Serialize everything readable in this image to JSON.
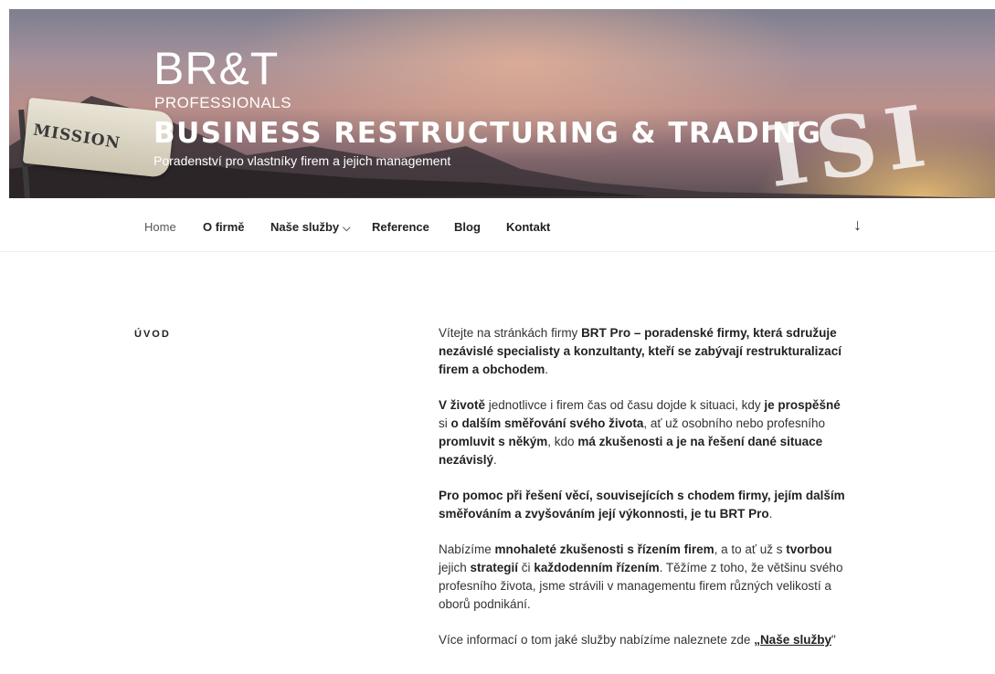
{
  "header": {
    "logo_main": "BR&T",
    "logo_sub": "PROFESSIONALS",
    "site_title": "BUSINESS RESTRUCTURING & TRADING",
    "site_description": "Poradenství pro vlastníky firem a jejich management",
    "banner_flag_text": "MISSION",
    "banner_big_letters": "ISI"
  },
  "nav": {
    "items": [
      {
        "label": "Home"
      },
      {
        "label": "O firmě"
      },
      {
        "label": "Naše služby"
      },
      {
        "label": "Reference"
      },
      {
        "label": "Blog"
      },
      {
        "label": "Kontakt"
      }
    ],
    "dropdown_icon": "chevron-down-icon",
    "scroll_icon": "arrow-down-icon"
  },
  "main": {
    "section_title": "ÚVOD",
    "p1": {
      "a": "Vítejte na stránkách firmy ",
      "b": "BRT Pro – poradenské firmy, která sdružuje nezávislé specialisty a konzultanty, kteří se zabývají restrukturalizací firem a obchodem",
      "c": "."
    },
    "p2": {
      "a": "V životě",
      "b": " jednotlivce i firem čas od času dojde k situaci, kdy ",
      "c": "je prospěšné",
      "d": " si ",
      "e": "o dalším směřování svého života",
      "f": ", ať už osobního nebo profesního ",
      "g": "promluvit s někým",
      "h": ", kdo ",
      "i": "má zkušenosti a je na řešení dané situace nezávislý",
      "j": "."
    },
    "p3": {
      "a": "Pro pomoc při řešení věcí, souvisejících s chodem firmy, jejím dalším směřováním a zvyšováním její výkonnosti,  je tu BRT Pro",
      "b": "."
    },
    "p4": {
      "a": "Nabízíme ",
      "b": "mnohaleté zkušenosti s řízením firem",
      "c": ", a to ať už s ",
      "d": "tvorbou",
      "e": " jejich ",
      "f": "strategií",
      "g": " či ",
      "h": "každodenním řízením",
      "i": ".  Těžíme z toho, že většinu svého profesního života, jsme strávili v managementu firem různých velikostí a oborů podnikání."
    },
    "p5": {
      "a": "Více informací o tom jaké služby nabízíme naleznete zde ",
      "open_quote": "„",
      "link": "Naše služby",
      "close_quote": "\""
    }
  }
}
